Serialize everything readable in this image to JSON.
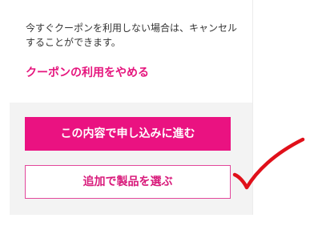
{
  "notice": {
    "text": "今すぐクーポンを利用しない場合は、キャンセルすることができます。",
    "cancel_link": "クーポンの利用をやめる"
  },
  "actions": {
    "proceed_label": "この内容で申し込みに進む",
    "add_product_label": "追加で製品を選ぶ"
  },
  "colors": {
    "accent": "#ea1281",
    "checkmark": "#e0101a"
  },
  "icons": {
    "annotation": "red-checkmark"
  }
}
